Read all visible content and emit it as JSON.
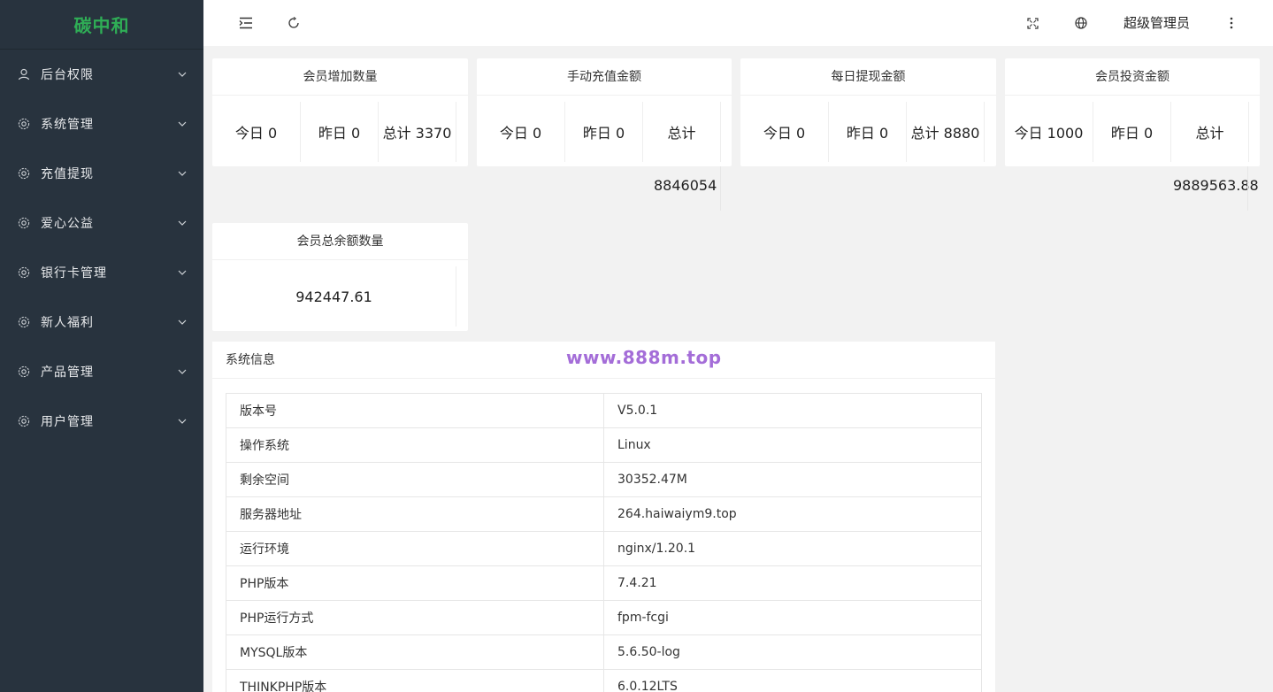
{
  "sidebar": {
    "logo": "碳中和",
    "items": [
      {
        "label": "后台权限",
        "icon": "user-icon"
      },
      {
        "label": "系统管理",
        "icon": "gear-icon"
      },
      {
        "label": "充值提现",
        "icon": "gear-icon"
      },
      {
        "label": "爱心公益",
        "icon": "gear-icon"
      },
      {
        "label": "银行卡管理",
        "icon": "gear-icon"
      },
      {
        "label": "新人福利",
        "icon": "gear-icon"
      },
      {
        "label": "产品管理",
        "icon": "gear-icon"
      },
      {
        "label": "用户管理",
        "icon": "gear-icon"
      }
    ]
  },
  "header": {
    "user": "超级管理员",
    "icons": [
      "menu-fold-icon",
      "refresh-icon",
      "fullscreen-icon",
      "globe-icon",
      "more-vertical-icon"
    ]
  },
  "stats": [
    {
      "title": "会员增加数量",
      "today": "今日 0",
      "yesterday": "昨日 0",
      "total": "总计 3370"
    },
    {
      "title": "手动充值金额",
      "today": "今日 0",
      "yesterday": "昨日 0",
      "total": "总计",
      "total_value": "8846054"
    },
    {
      "title": "每日提现金额",
      "today": "今日 0",
      "yesterday": "昨日 0",
      "total": "总计 8880"
    },
    {
      "title": "会员投资金额",
      "today": "今日 1000",
      "yesterday": "昨日 0",
      "total": "总计",
      "total_value": "9889563.88"
    },
    {
      "title": "会员总余额数量",
      "value": "942447.61"
    }
  ],
  "system": {
    "title": "系统信息",
    "watermark": "www.888m.top",
    "rows": [
      {
        "key": "版本号",
        "value": "V5.0.1"
      },
      {
        "key": "操作系统",
        "value": "Linux"
      },
      {
        "key": "剩余空间",
        "value": "30352.47M"
      },
      {
        "key": "服务器地址",
        "value": "264.haiwaiym9.top"
      },
      {
        "key": "运行环境",
        "value": "nginx/1.20.1"
      },
      {
        "key": "PHP版本",
        "value": "7.4.21"
      },
      {
        "key": "PHP运行方式",
        "value": "fpm-fcgi"
      },
      {
        "key": "MYSQL版本",
        "value": "5.6.50-log"
      },
      {
        "key": "THINKPHP版本",
        "value": "6.0.12LTS"
      }
    ]
  },
  "colors": {
    "sidebar_bg": "#28333e",
    "logo": "#2fae56",
    "watermark": "#a46dd8"
  }
}
